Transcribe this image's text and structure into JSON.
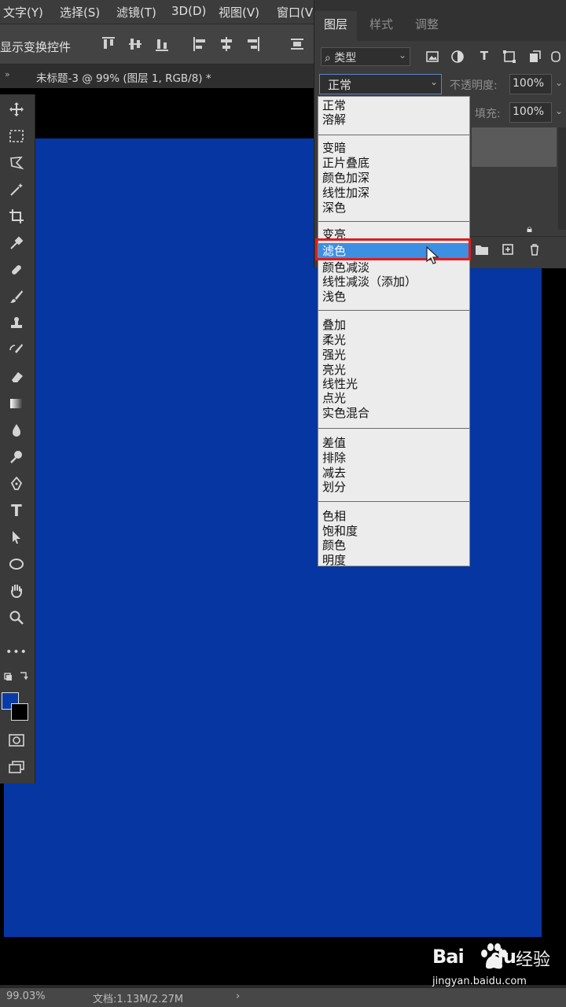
{
  "menubar": {
    "items": [
      "文字(Y)",
      "选择(S)",
      "滤镜(T)",
      "3D(D)",
      "视图(V)",
      "窗口(V"
    ]
  },
  "options_bar": {
    "label": "显示变换控件"
  },
  "document": {
    "tab_title": "未标题-3 @ 99% (图层 1, RGB/8) *",
    "tab_arrows": "»",
    "canvas_color": "#0636a2"
  },
  "toolbar": {
    "tools": [
      "move",
      "marquee",
      "lasso",
      "magic-wand",
      "crop",
      "eyedropper",
      "healing",
      "brush",
      "stamp",
      "history-brush",
      "eraser",
      "gradient",
      "blur",
      "dodge",
      "pen",
      "type",
      "path-select",
      "ellipse",
      "hand",
      "zoom",
      "more",
      "swap",
      "quick-mask",
      "screen-mode"
    ],
    "type_glyph": "T",
    "more_glyph": "•••",
    "foreground_color": "#0a3aa8",
    "background_color": "#000000"
  },
  "status": {
    "zoom": "99.03%",
    "doc_info": "文档:1.13M/2.27M",
    "arrow": "›"
  },
  "layers_panel": {
    "tabs": [
      "图层",
      "样式",
      "调整"
    ],
    "active_tab": "图层",
    "filter": {
      "label": "类型"
    },
    "filter_icons": [
      "image-icon",
      "adjust-icon",
      "type-icon",
      "shape-icon",
      "smart-icon"
    ],
    "type_glyph": "T",
    "blend_mode": "正常",
    "opacity_label": "不透明度:",
    "opacity_value": "100%",
    "fill_label": "填充:",
    "fill_value": "100%"
  },
  "blend_dropdown": {
    "groups": [
      [
        "正常",
        "溶解"
      ],
      [
        "变暗",
        "正片叠底",
        "颜色加深",
        "线性加深",
        "深色"
      ],
      [
        "变亮",
        "滤色",
        "颜色减淡",
        "线性减淡（添加）",
        "浅色"
      ],
      [
        "叠加",
        "柔光",
        "强光",
        "亮光",
        "线性光",
        "点光",
        "实色混合"
      ],
      [
        "差值",
        "排除",
        "减去",
        "划分"
      ],
      [
        "色相",
        "饱和度",
        "颜色",
        "明度"
      ]
    ],
    "highlighted": "滤色",
    "highlight_color": "#3d8fe2",
    "annotation_color": "#e21b1b"
  },
  "watermark": {
    "logo": "Bai",
    "logo_suffix": "du",
    "text": "经验",
    "url": "jingyan.baidu.com"
  }
}
